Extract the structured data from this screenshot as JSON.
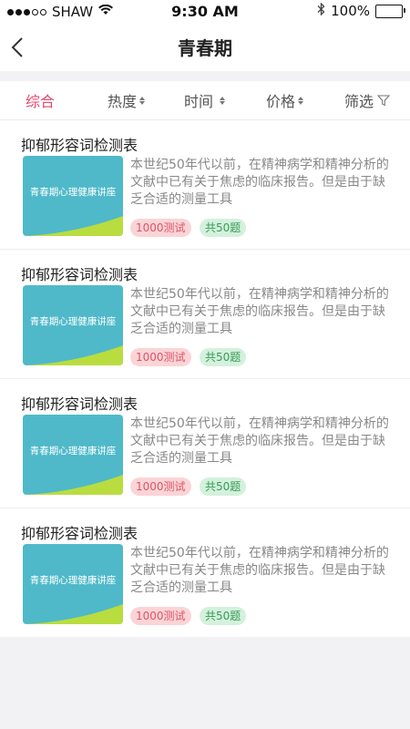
{
  "status": {
    "carrier": "SHAW",
    "time": "9:30 AM",
    "battery": "100%"
  },
  "nav": {
    "title": "青春期"
  },
  "filters": [
    {
      "label": "综合",
      "active": true
    },
    {
      "label": "热度",
      "active": false
    },
    {
      "label": "时间",
      "active": false
    },
    {
      "label": "价格",
      "active": false
    },
    {
      "label": "筛选",
      "active": false
    }
  ],
  "items": [
    {
      "title": "抑郁形容词检测表",
      "thumb": "青春期心理健康讲座",
      "desc": "本世纪50年代以前，在精神病学和精神分析的文献中已有关于焦虑的临床报告。但是由于缺乏合适的测量工具",
      "tests": "1000测试",
      "count": "共50题"
    },
    {
      "title": "抑郁形容词检测表",
      "thumb": "青春期心理健康讲座",
      "desc": "本世纪50年代以前，在精神病学和精神分析的文献中已有关于焦虑的临床报告。但是由于缺乏合适的测量工具",
      "tests": "1000测试",
      "count": "共50题"
    },
    {
      "title": "抑郁形容词检测表",
      "thumb": "青春期心理健康讲座",
      "desc": "本世纪50年代以前，在精神病学和精神分析的文献中已有关于焦虑的临床报告。但是由于缺乏合适的测量工具",
      "tests": "1000测试",
      "count": "共50题"
    },
    {
      "title": "抑郁形容词检测表",
      "thumb": "青春期心理健康讲座",
      "desc": "本世纪50年代以前，在精神病学和精神分析的文献中已有关于焦虑的临床报告。但是由于缺乏合适的测量工具",
      "tests": "1000测试",
      "count": "共50题"
    }
  ],
  "colors": {
    "accent": "#e5466b",
    "thumb_bg": "#4fb9c9",
    "thumb_swoosh": "#b9dd3f",
    "tag_tests_bg": "#fbd4d6",
    "tag_count_bg": "#d3f1dc"
  }
}
